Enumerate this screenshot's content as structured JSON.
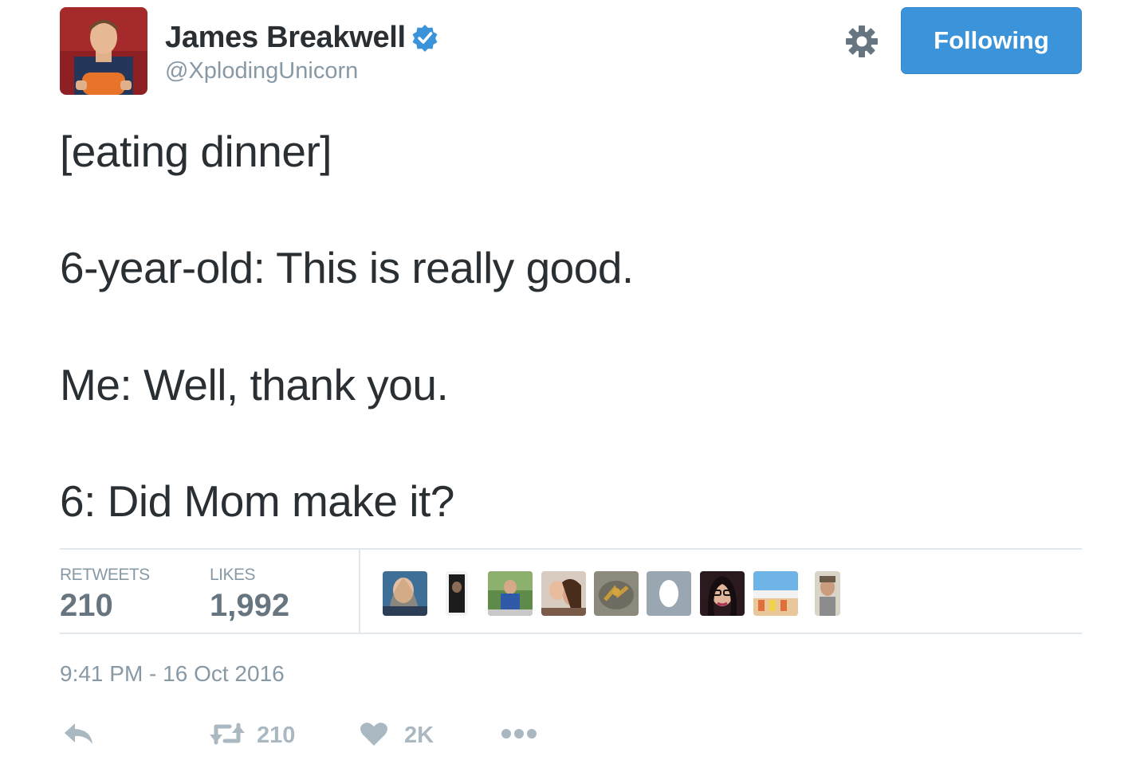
{
  "profile": {
    "display_name": "James Breakwell",
    "handle": "@XplodingUnicorn",
    "verified_icon": "verified-badge-icon"
  },
  "header": {
    "follow_button_label": "Following",
    "settings_icon": "gear-icon"
  },
  "tweet": {
    "lines": [
      "[eating dinner]",
      "6-year-old: This is really good.",
      "Me: Well, thank you.",
      "6: Did Mom make it?"
    ]
  },
  "stats": {
    "retweets_label": "RETWEETS",
    "retweets_value": "210",
    "likes_label": "LIKES",
    "likes_value": "1,992"
  },
  "timestamp": "9:41 PM - 16 Oct 2016",
  "actions": {
    "reply_icon": "reply-icon",
    "retweet_icon": "retweet-icon",
    "retweet_count": "210",
    "like_icon": "heart-icon",
    "like_count": "2K",
    "more_icon": "more-dots-icon"
  },
  "colors": {
    "accent": "#3b94d9",
    "text": "#292f33",
    "muted": "#8899a6",
    "stat_value": "#66757f",
    "action_icon": "#aab8c2",
    "divider": "#e1e8ed"
  }
}
